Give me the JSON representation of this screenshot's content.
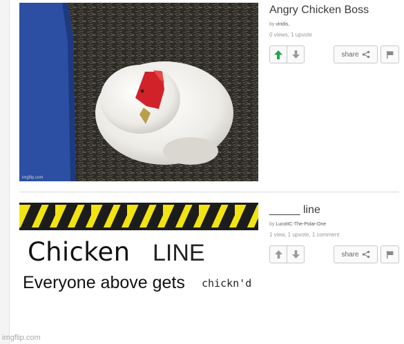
{
  "site": {
    "watermark": "imgflip.com"
  },
  "posts": [
    {
      "image_watermark": "imgflip.com",
      "title": "Angry Chicken Boss",
      "by_prefix": "by",
      "author": "viridis,",
      "stats": "0 views, 1 upvote",
      "share_label": "share",
      "upvoted": true,
      "icons": {
        "up": "arrow-up-icon",
        "down": "arrow-down-icon",
        "share": "share-icon",
        "flag": "flag-icon"
      },
      "colors": {
        "upvote_active": "#1fa84a",
        "vote_inactive": "#9a9a9a"
      }
    },
    {
      "title": "_____ line",
      "by_prefix": "by",
      "author": "LucotIC-The-Polar-One",
      "stats": "1 view, 1 upvote, 1 comment",
      "share_label": "share",
      "upvoted": false,
      "meme": {
        "line1_big": "Chicken",
        "line1_small": "LINE",
        "line2_big": "Everyone above gets",
        "line2_small": "chickn'd"
      },
      "colors": {
        "stripe_yellow": "#f2e410",
        "stripe_black": "#1c1c1c"
      }
    }
  ]
}
